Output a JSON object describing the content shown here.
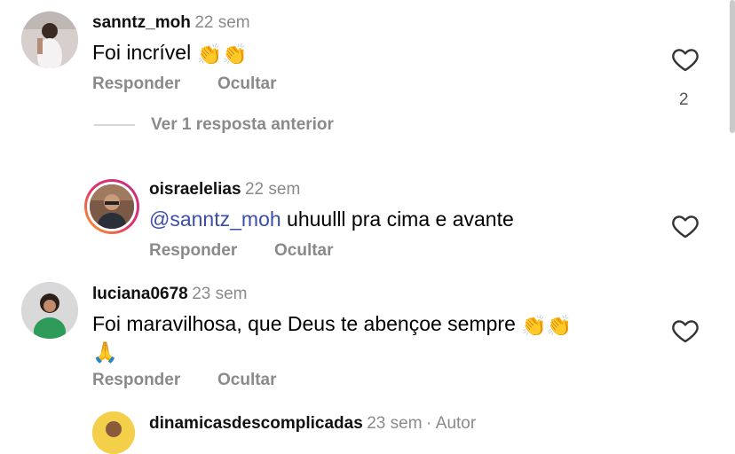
{
  "comments": [
    {
      "username": "sanntz_moh",
      "time": "22 sem",
      "text": "Foi incrível",
      "emoji": "👏👏",
      "reply_label": "Responder",
      "hide_label": "Ocultar",
      "likes": "2"
    },
    {
      "view_replies_label": "Ver 1 resposta anterior"
    },
    {
      "username": "oisraelelias",
      "time": "22 sem",
      "mention": "@sanntz_moh",
      "text": "uhuulll pra cima e avante",
      "reply_label": "Responder",
      "hide_label": "Ocultar"
    },
    {
      "username": "luciana0678",
      "time": "23 sem",
      "text": "Foi maravilhosa, que Deus te abençoe sempre",
      "emoji": "👏👏",
      "emoji_line2": "🙏",
      "reply_label": "Responder",
      "hide_label": "Ocultar"
    },
    {
      "username": "dinamicasdescomplicadas",
      "time": "23 sem",
      "separator": "·",
      "author_label": "Autor"
    }
  ],
  "colors": {
    "mention": "#3b4fa8",
    "secondary_text": "#8a8a8a",
    "story_ring_start": "#f9a825",
    "story_ring_end": "#c13584"
  },
  "icons": [
    "heart-icon",
    "avatar"
  ]
}
